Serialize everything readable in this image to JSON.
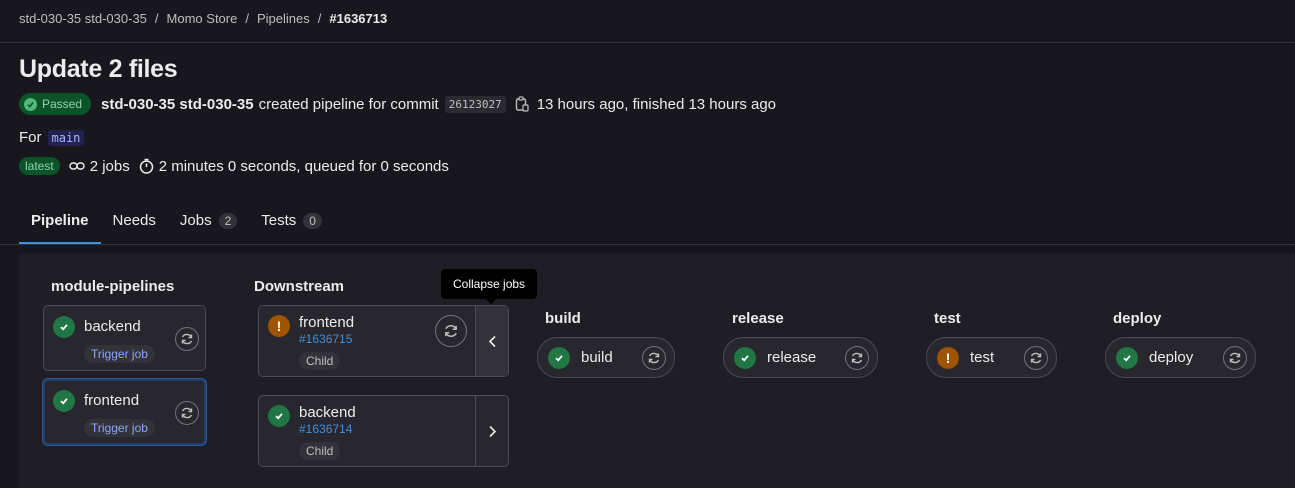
{
  "breadcrumb": {
    "group": "std-030-35 std-030-35",
    "project": "Momo Store",
    "section": "Pipelines",
    "current": "#1636713",
    "separator": "/"
  },
  "pipeline": {
    "title": "Update 2 files",
    "status": "Passed",
    "author": "std-030-35 std-030-35",
    "created_text": "created pipeline for commit",
    "commit_sha": "26123027",
    "time_text": "13 hours ago, finished 13 hours ago",
    "for_label": "For",
    "branch": "main",
    "latest_badge": "latest",
    "jobs_text": "2 jobs",
    "duration_text": "2 minutes 0 seconds, queued for 0 seconds"
  },
  "tabs": [
    {
      "label": "Pipeline",
      "count": null
    },
    {
      "label": "Needs",
      "count": null
    },
    {
      "label": "Jobs",
      "count": "2"
    },
    {
      "label": "Tests",
      "count": "0"
    }
  ],
  "graph": {
    "tooltip": "Collapse jobs",
    "upstream": {
      "title": "module-pipelines",
      "jobs": [
        {
          "name": "backend",
          "tag": "Trigger job",
          "status": "success"
        },
        {
          "name": "frontend",
          "tag": "Trigger job",
          "status": "success"
        }
      ]
    },
    "downstream": {
      "title": "Downstream",
      "pipelines": [
        {
          "name": "frontend",
          "id": "#1636715",
          "tag": "Child",
          "status": "warning"
        },
        {
          "name": "backend",
          "id": "#1636714",
          "tag": "Child",
          "status": "success"
        }
      ]
    },
    "stages": [
      {
        "title": "build",
        "job": "build",
        "status": "success"
      },
      {
        "title": "release",
        "job": "release",
        "status": "success"
      },
      {
        "title": "test",
        "job": "test",
        "status": "warning"
      },
      {
        "title": "deploy",
        "job": "deploy",
        "status": "success"
      }
    ]
  },
  "colors": {
    "success": "#217645",
    "warning": "#9e5400",
    "link": "#428fdc",
    "background": "#18171d"
  }
}
